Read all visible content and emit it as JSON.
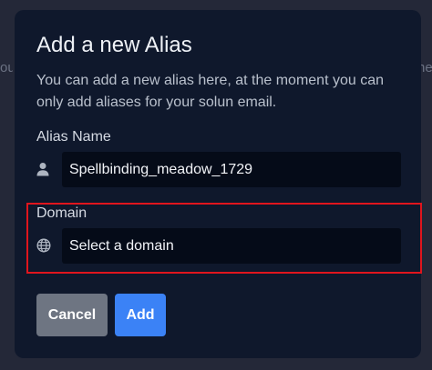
{
  "backdrop": {
    "left_text": "ou",
    "right_text": "ne"
  },
  "modal": {
    "title": "Add a new Alias",
    "description": "You can add a new alias here, at the moment you can only add aliases for your solun email.",
    "alias_field": {
      "label": "Alias Name",
      "icon": "user-icon",
      "value": "Spellbinding_meadow_1729"
    },
    "domain_field": {
      "label": "Domain",
      "icon": "globe-icon",
      "selected": "Select a domain"
    },
    "buttons": {
      "cancel": "Cancel",
      "add": "Add"
    }
  },
  "colors": {
    "backdrop": "#242838",
    "modal_bg": "#0f182c",
    "input_bg": "#050b18",
    "cancel_bg": "#6e7582",
    "add_bg": "#3b82f6",
    "highlight": "#e0151d"
  }
}
